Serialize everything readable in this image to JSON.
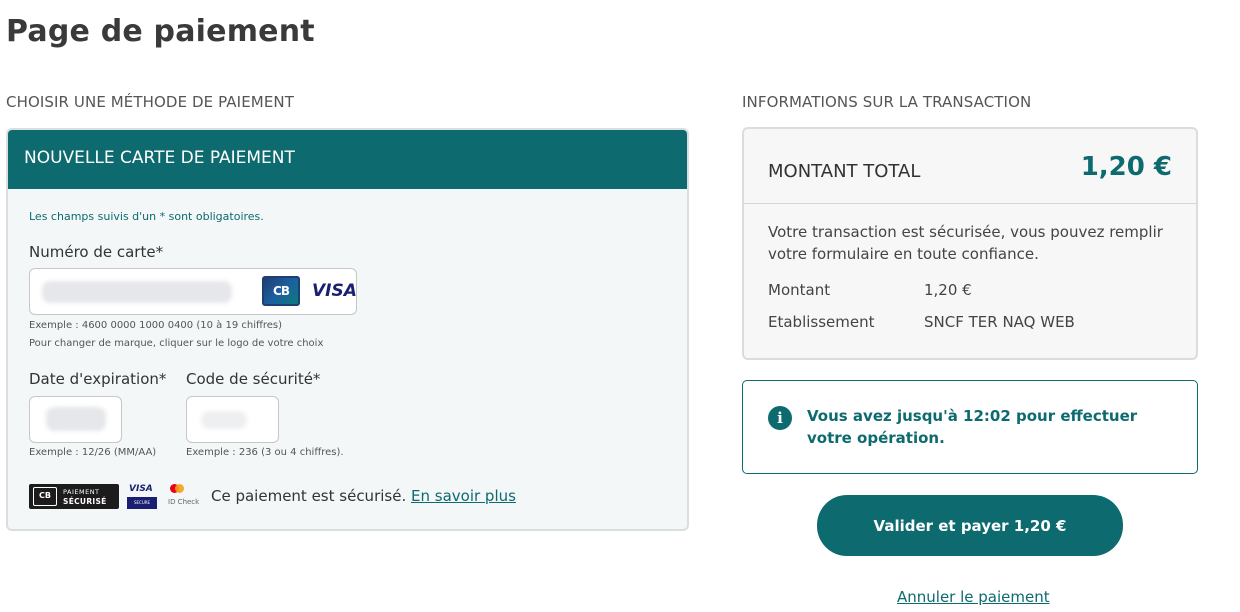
{
  "page": {
    "title": "Page de paiement"
  },
  "payment_method": {
    "heading": "CHOISIR UNE MÉTHODE DE PAIEMENT",
    "card_header": "NOUVELLE CARTE DE PAIEMENT",
    "required_note": "Les champs suivis d'un * sont obligatoires.",
    "card_number": {
      "label": "Numéro de carte*",
      "hint_example": "Exemple : 4600 0000 1000 0400 (10 à 19 chiffres)",
      "hint_brand": "Pour changer de marque, cliquer sur le logo de votre choix",
      "brand_cb": "CB",
      "brand_visa": "VISA"
    },
    "expiry": {
      "label": "Date d'expiration*",
      "hint": "Exemple : 12/26 (MM/AA)"
    },
    "security_code": {
      "label": "Code de sécurité*",
      "hint": "Exemple : 236 (3 ou 4 chiffres)."
    },
    "secure_badges": {
      "cb_text": "CB",
      "paiement": "PAIEMENT",
      "securise": "SÉCURISÉ",
      "visa": "VISA",
      "visa_secure": "SECURE",
      "id_check": "ID Check"
    },
    "secure_text": "Ce paiement est sécurisé.",
    "learn_more": "En savoir plus"
  },
  "transaction": {
    "heading": "INFORMATIONS SUR LA TRANSACTION",
    "total_label": "MONTANT TOTAL",
    "total_amount": "1,20 €",
    "secure_message": "Votre transaction est sécurisée, vous pouvez remplir votre formulaire en toute confiance.",
    "amount_label": "Montant",
    "amount_value": "1,20 €",
    "merchant_label": "Etablissement",
    "merchant_value": "SNCF TER NAQ WEB"
  },
  "timer": {
    "icon": "i",
    "message": "Vous avez jusqu'à 12:02 pour effectuer votre opération."
  },
  "actions": {
    "pay_label": "Valider et payer 1,20 €",
    "cancel_label": "Annuler le paiement"
  },
  "colors": {
    "brand_teal": "#0d6a6e",
    "card_bg": "#f3f7f7",
    "summary_bg": "#f7f7f7"
  }
}
